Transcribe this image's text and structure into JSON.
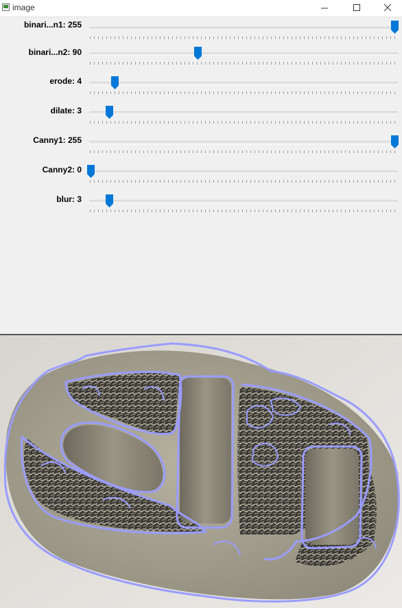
{
  "window": {
    "title": "image"
  },
  "colors": {
    "thumb": "#0078d7",
    "contour": "#9a9cff",
    "bg": "#f0f0f0"
  },
  "trackbars": [
    {
      "label": "binari...n1: 255",
      "value": 255,
      "max": 255
    },
    {
      "label": "binari...n2: 90",
      "value": 90,
      "max": 255
    },
    {
      "label": "erode: 4",
      "value": 4,
      "max": 50
    },
    {
      "label": "dilate: 3",
      "value": 3,
      "max": 50
    },
    {
      "label": "Canny1: 255",
      "value": 255,
      "max": 255
    },
    {
      "label": "Canny2: 0",
      "value": 0,
      "max": 255
    },
    {
      "label": "blur: 3",
      "value": 3,
      "max": 50
    }
  ]
}
